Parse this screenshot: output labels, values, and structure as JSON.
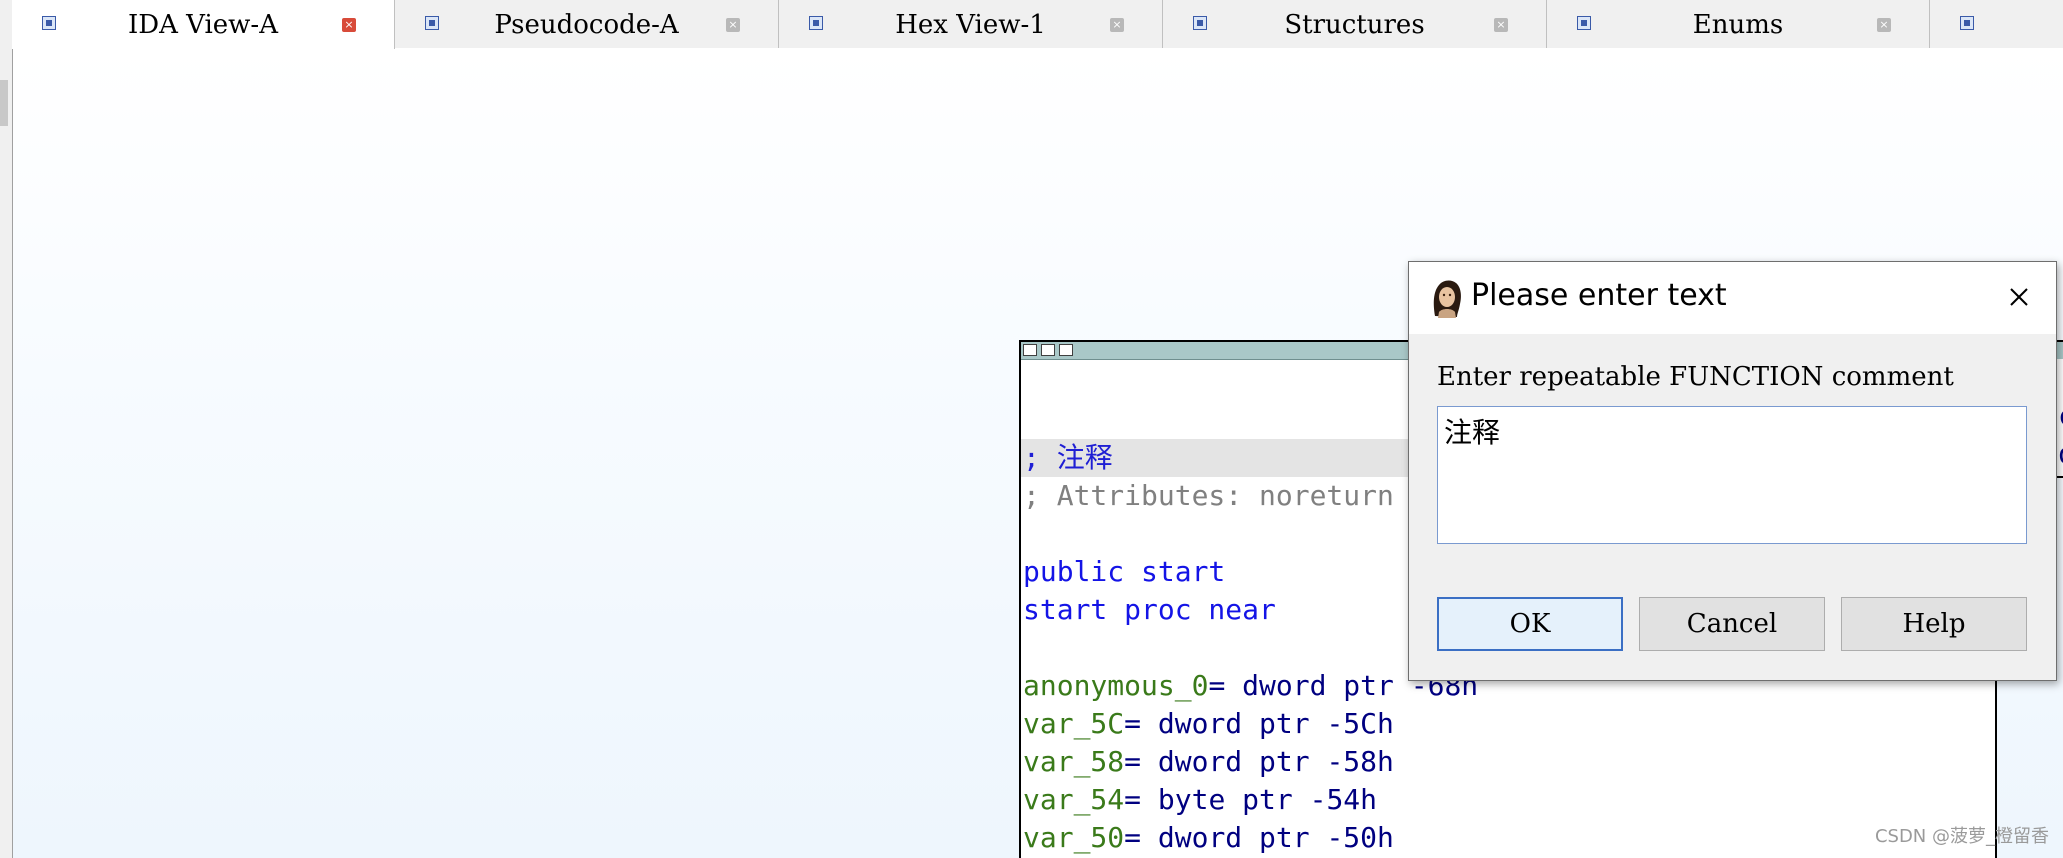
{
  "tabs": [
    {
      "label": "IDA View-A",
      "active": true,
      "icon": "ida-view-icon"
    },
    {
      "label": "Pseudocode-A",
      "active": false,
      "icon": "pseudocode-icon"
    },
    {
      "label": "Hex View-1",
      "active": false,
      "icon": "hex-view-icon"
    },
    {
      "label": "Structures",
      "active": false,
      "icon": "structures-icon"
    },
    {
      "label": "Enums",
      "active": false,
      "icon": "enums-icon"
    }
  ],
  "code": {
    "lines": [
      {
        "text": "; 注释",
        "kind": "comment"
      },
      {
        "text": "; Attributes: noreturn",
        "kind": "gray"
      },
      {
        "text": "public start",
        "kind": "blue"
      },
      {
        "text": "start proc near",
        "kind": "blue"
      },
      {
        "var": "anonymous_0",
        "decl": "= dword ptr -68h"
      },
      {
        "var": "var_5C",
        "decl": "= dword ptr -5Ch"
      },
      {
        "var": "var_58",
        "decl": "= dword ptr -58h"
      },
      {
        "var": "var_54",
        "decl": "= byte ptr -54h"
      },
      {
        "var": "var_50",
        "decl": "= dword ptr -50h"
      }
    ]
  },
  "side_node": {
    "lines": [
      "c",
      "o"
    ]
  },
  "dialog": {
    "title": "Please enter text",
    "prompt": "Enter repeatable FUNCTION comment",
    "value": "注释",
    "buttons": {
      "ok": "OK",
      "cancel": "Cancel",
      "help": "Help"
    }
  },
  "watermark": "CSDN @菠萝_橙留香",
  "colors": {
    "accent": "#3b6fc4",
    "comment": "#1f1fd4",
    "keyword": "#1414e6",
    "var_name": "#3a7a1a",
    "operand": "#000080",
    "node_header": "#a9c8c8"
  }
}
